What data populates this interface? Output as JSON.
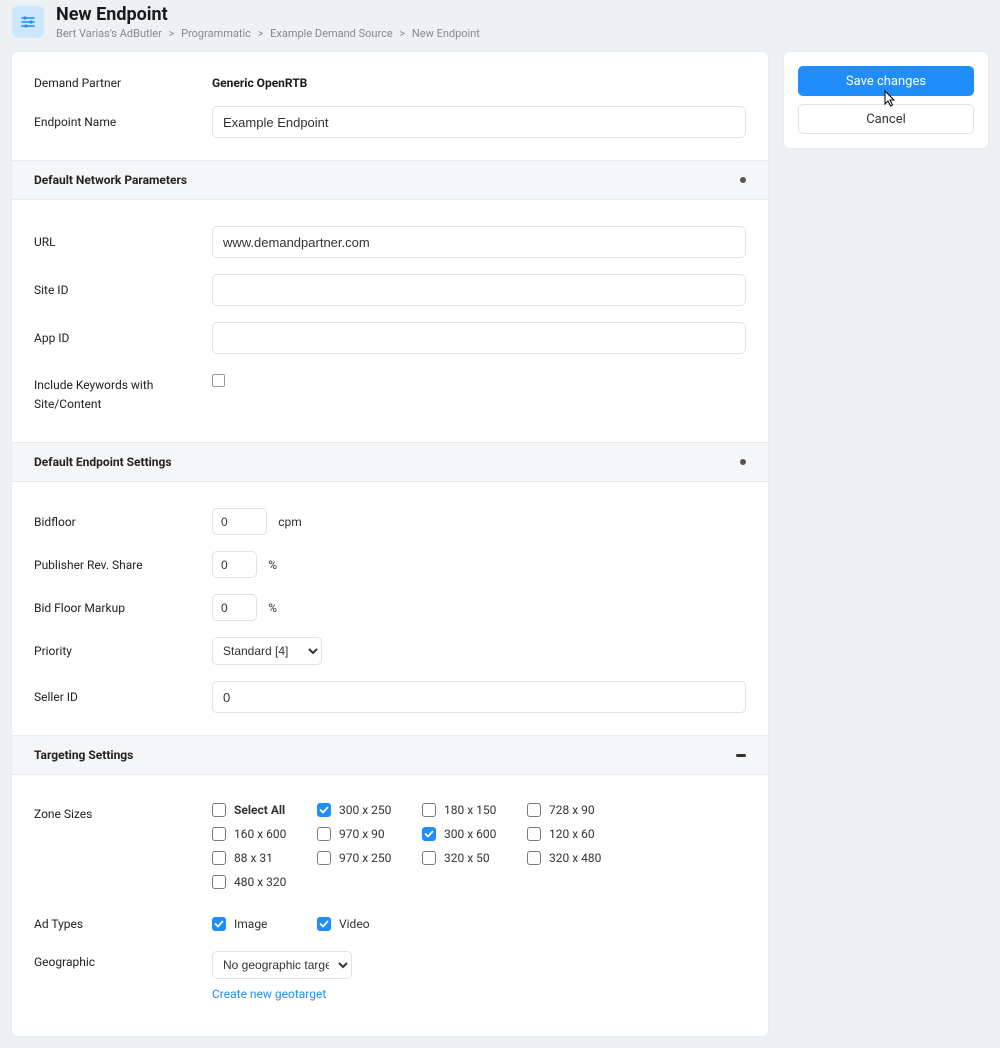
{
  "header": {
    "title": "New Endpoint",
    "breadcrumb": [
      "Bert Varias's AdButler",
      "Programmatic",
      "Example Demand Source",
      "New Endpoint"
    ]
  },
  "actions": {
    "save": "Save changes",
    "cancel": "Cancel"
  },
  "general": {
    "demand_partner_label": "Demand Partner",
    "demand_partner_value": "Generic OpenRTB",
    "endpoint_name_label": "Endpoint Name",
    "endpoint_name_value": "Example Endpoint"
  },
  "network": {
    "section_title": "Default Network Parameters",
    "url_label": "URL",
    "url_value": "www.demandpartner.com",
    "site_id_label": "Site ID",
    "site_id_value": "",
    "app_id_label": "App ID",
    "app_id_value": "",
    "include_keywords_label": "Include Keywords with Site/Content",
    "include_keywords_checked": false
  },
  "endpoint": {
    "section_title": "Default Endpoint Settings",
    "bidfloor_label": "Bidfloor",
    "bidfloor_value": "0",
    "bidfloor_suffix": "cpm",
    "pubrev_label": "Publisher Rev. Share",
    "pubrev_value": "0",
    "pubrev_suffix": "%",
    "markup_label": "Bid Floor Markup",
    "markup_value": "0",
    "markup_suffix": "%",
    "priority_label": "Priority",
    "priority_value": "Standard [4]",
    "seller_id_label": "Seller ID",
    "seller_id_value": "0"
  },
  "targeting": {
    "section_title": "Targeting Settings",
    "zone_sizes_label": "Zone Sizes",
    "sizes": [
      {
        "label": "Select All",
        "checked": false,
        "bold": true
      },
      {
        "label": "300 x 250",
        "checked": true
      },
      {
        "label": "180 x 150",
        "checked": false
      },
      {
        "label": "728 x 90",
        "checked": false
      },
      {
        "label": "",
        "checked": null
      },
      {
        "label": "160 x 600",
        "checked": false
      },
      {
        "label": "970 x 90",
        "checked": false
      },
      {
        "label": "300 x 600",
        "checked": true
      },
      {
        "label": "120 x 60",
        "checked": false
      },
      {
        "label": "",
        "checked": null
      },
      {
        "label": "88 x 31",
        "checked": false
      },
      {
        "label": "970 x 250",
        "checked": false
      },
      {
        "label": "320 x 50",
        "checked": false
      },
      {
        "label": "320 x 480",
        "checked": false
      },
      {
        "label": "",
        "checked": null
      },
      {
        "label": "480 x 320",
        "checked": false
      }
    ],
    "ad_types_label": "Ad Types",
    "ad_types": [
      {
        "label": "Image",
        "checked": true
      },
      {
        "label": "Video",
        "checked": true
      }
    ],
    "geo_label": "Geographic",
    "geo_value": "No geographic target",
    "geo_link": "Create new geotarget"
  }
}
